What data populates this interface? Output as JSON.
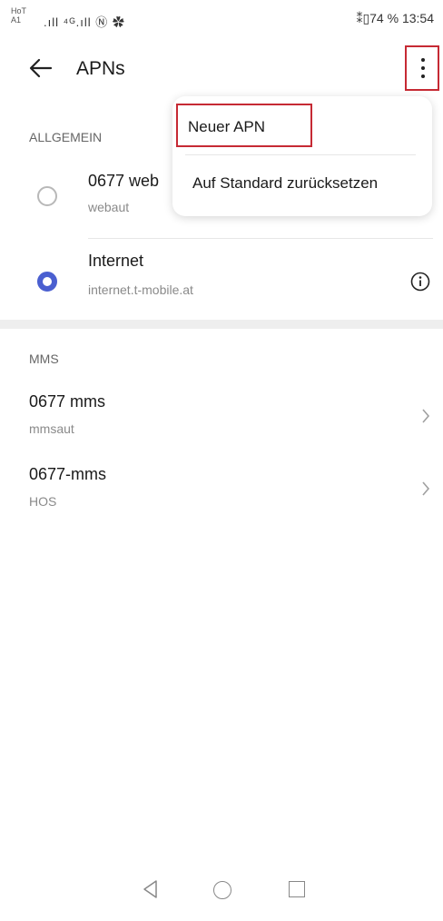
{
  "status_bar": {
    "carrier_line1": "HoT",
    "carrier_line2": "A1",
    "signal_text": ".ıll ⁴ᴳ.ıll Ⓝ ✿",
    "battery_text": "⁑▯74 %",
    "time": "13:54"
  },
  "header": {
    "title": "APNs",
    "back_icon": "arrow-left-icon",
    "more_icon": "more-vertical-icon"
  },
  "menu": {
    "items": [
      {
        "label": "Neuer APN"
      },
      {
        "label": "Auf Standard zurücksetzen"
      }
    ]
  },
  "sections": [
    {
      "label": "ALLGEMEIN",
      "items": [
        {
          "title": "0677 web",
          "subtitle": "webaut",
          "selected": false
        },
        {
          "title": "Internet",
          "subtitle": "internet.t-mobile.at",
          "selected": true,
          "icon": "info-icon"
        }
      ]
    },
    {
      "label": "MMS",
      "items": [
        {
          "title": "0677 mms",
          "subtitle": "mmsaut",
          "icon": "chevron-right-icon"
        },
        {
          "title": "0677-mms",
          "subtitle": "HOS",
          "icon": "chevron-right-icon"
        }
      ]
    }
  ],
  "colors": {
    "accent": "#4a5fd0",
    "highlight_border": "#c62a34",
    "text_primary": "#1a1a1a",
    "text_secondary": "#8a8a8a"
  },
  "nav_bar": {
    "back_icon": "triangle-back-icon",
    "home_icon": "circle-home-icon",
    "recents_icon": "square-recents-icon"
  }
}
